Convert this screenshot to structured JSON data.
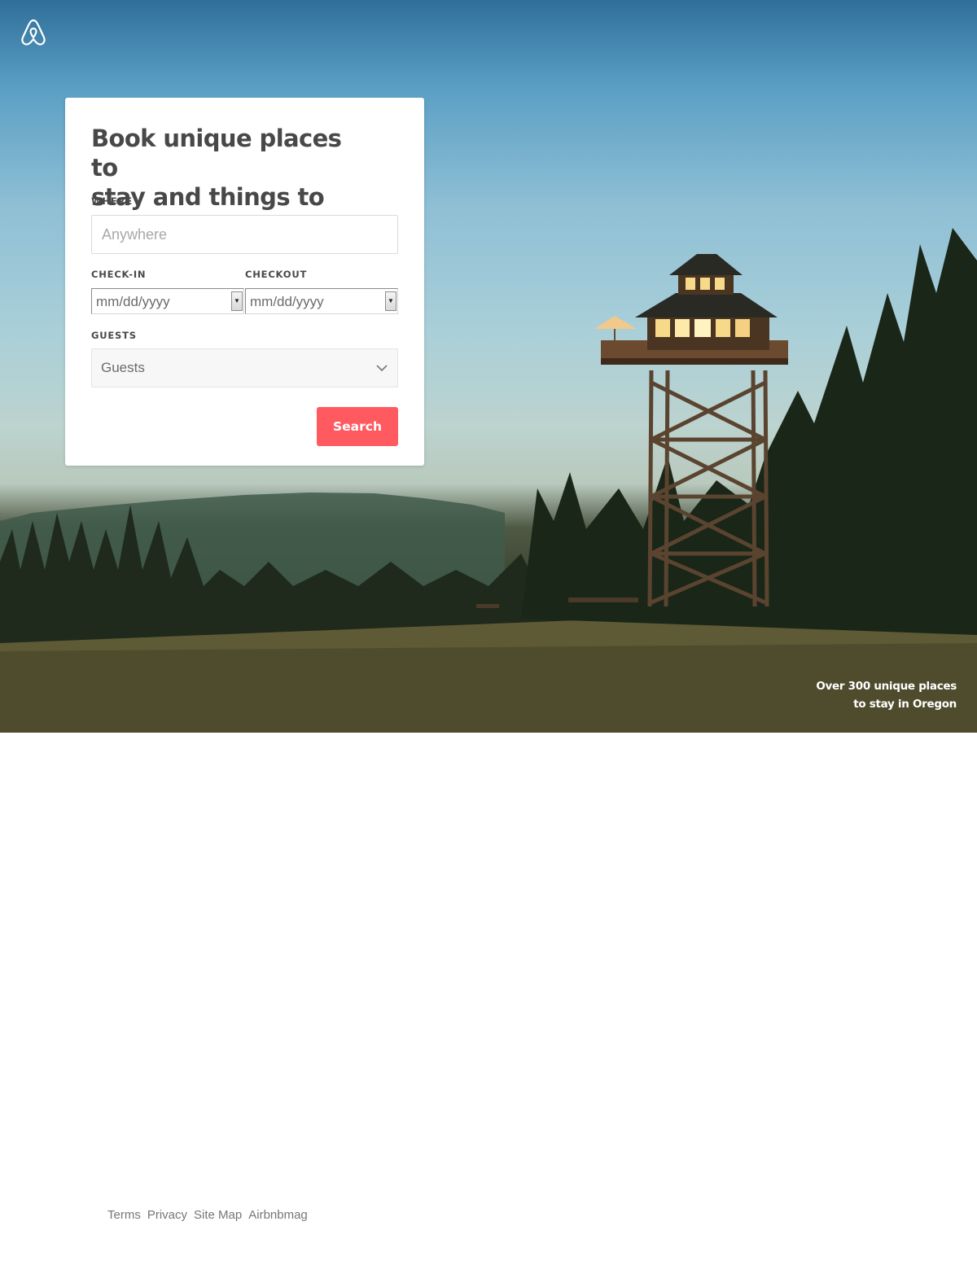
{
  "hero": {
    "caption_line1": "Over 300 unique places",
    "caption_line2": "to stay in Oregon"
  },
  "search_card": {
    "title_line1": "Book unique places to",
    "title_line2": "stay and things to do.",
    "where": {
      "label": "WHERE",
      "placeholder": "Anywhere"
    },
    "checkin": {
      "label": "CHECK-IN",
      "placeholder": "mm/dd/yyyy"
    },
    "checkout": {
      "label": "CHECKOUT",
      "placeholder": "mm/dd/yyyy"
    },
    "guests": {
      "label": "GUESTS",
      "value": "Guests"
    },
    "search_button": "Search"
  },
  "footer": {
    "links": [
      "Terms",
      "Privacy",
      "Site Map",
      "Airbnbmag"
    ]
  },
  "colors": {
    "accent": "#ff5a5f",
    "text": "#484848",
    "footer_text": "#767676"
  },
  "icons": {
    "logo": "airbnb-logo-icon",
    "select_arrow": "chevron-down-icon"
  }
}
